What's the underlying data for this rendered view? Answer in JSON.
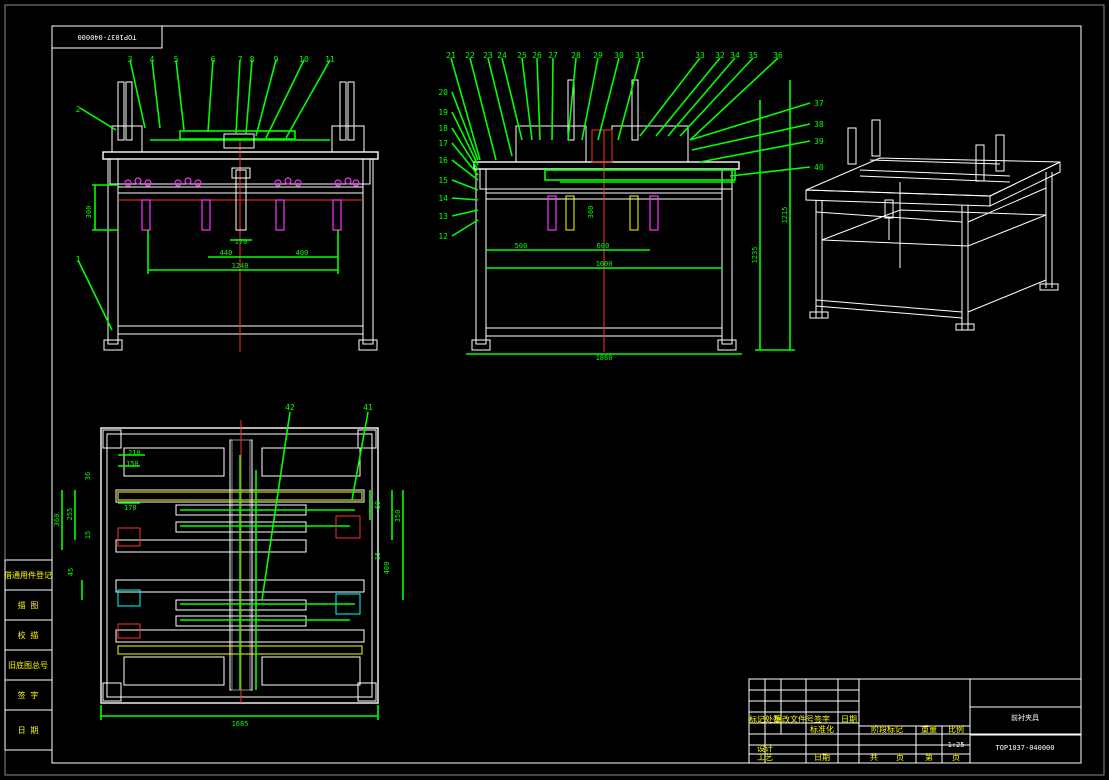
{
  "drawing_number_stamp": "TOP1037-040000",
  "front_view": {
    "balloons_top": [
      "3",
      "4",
      "5",
      "6",
      "7",
      "8",
      "9",
      "10",
      "11"
    ],
    "balloons_left": [
      "2",
      "1"
    ],
    "dimensions": {
      "height": "300",
      "gap": "170",
      "span_inner": "440",
      "span_right": "400",
      "overall": "1240"
    }
  },
  "side_view": {
    "balloons_top": [
      "21",
      "22",
      "23",
      "24",
      "25",
      "26",
      "27",
      "28",
      "29",
      "30",
      "31",
      "33",
      "32",
      "34",
      "35",
      "36"
    ],
    "balloons_left": [
      "20",
      "19",
      "18",
      "17",
      "16",
      "15",
      "14",
      "13",
      "12"
    ],
    "balloons_right": [
      "37",
      "38",
      "39",
      "40"
    ],
    "dimensions": {
      "left": "500",
      "right": "600",
      "inner_height": "300",
      "total_width": "1600",
      "overall_width": "1860",
      "height": "1235",
      "overall_height": "1215"
    }
  },
  "plan_view": {
    "balloons": [
      "42",
      "41"
    ],
    "dimensions": {
      "a": "210",
      "b": "150",
      "c": "36",
      "d": "170",
      "e": "360",
      "f": "255",
      "g": "15",
      "h": "45",
      "i": "350",
      "j": "60",
      "k": "15",
      "l": "400",
      "m": "1685"
    }
  },
  "left_strip": [
    "借通用件登记",
    "描   图",
    "校   描",
    "旧底图总号",
    "签   字",
    "日   期"
  ],
  "title_block": {
    "name": "前衬夹具",
    "number": "TOP1037-040000",
    "scale": "1:25",
    "cells_top": [
      "标记",
      "处数",
      "更改文件号",
      "签字",
      "日期"
    ],
    "cells_bottom_a": [
      "设计",
      "工艺"
    ],
    "cells_bottom_b": [
      "标准化",
      "日期"
    ],
    "mid_labels": [
      "阶段标记",
      "重量",
      "比例",
      "共",
      "页",
      "第",
      "页"
    ]
  }
}
